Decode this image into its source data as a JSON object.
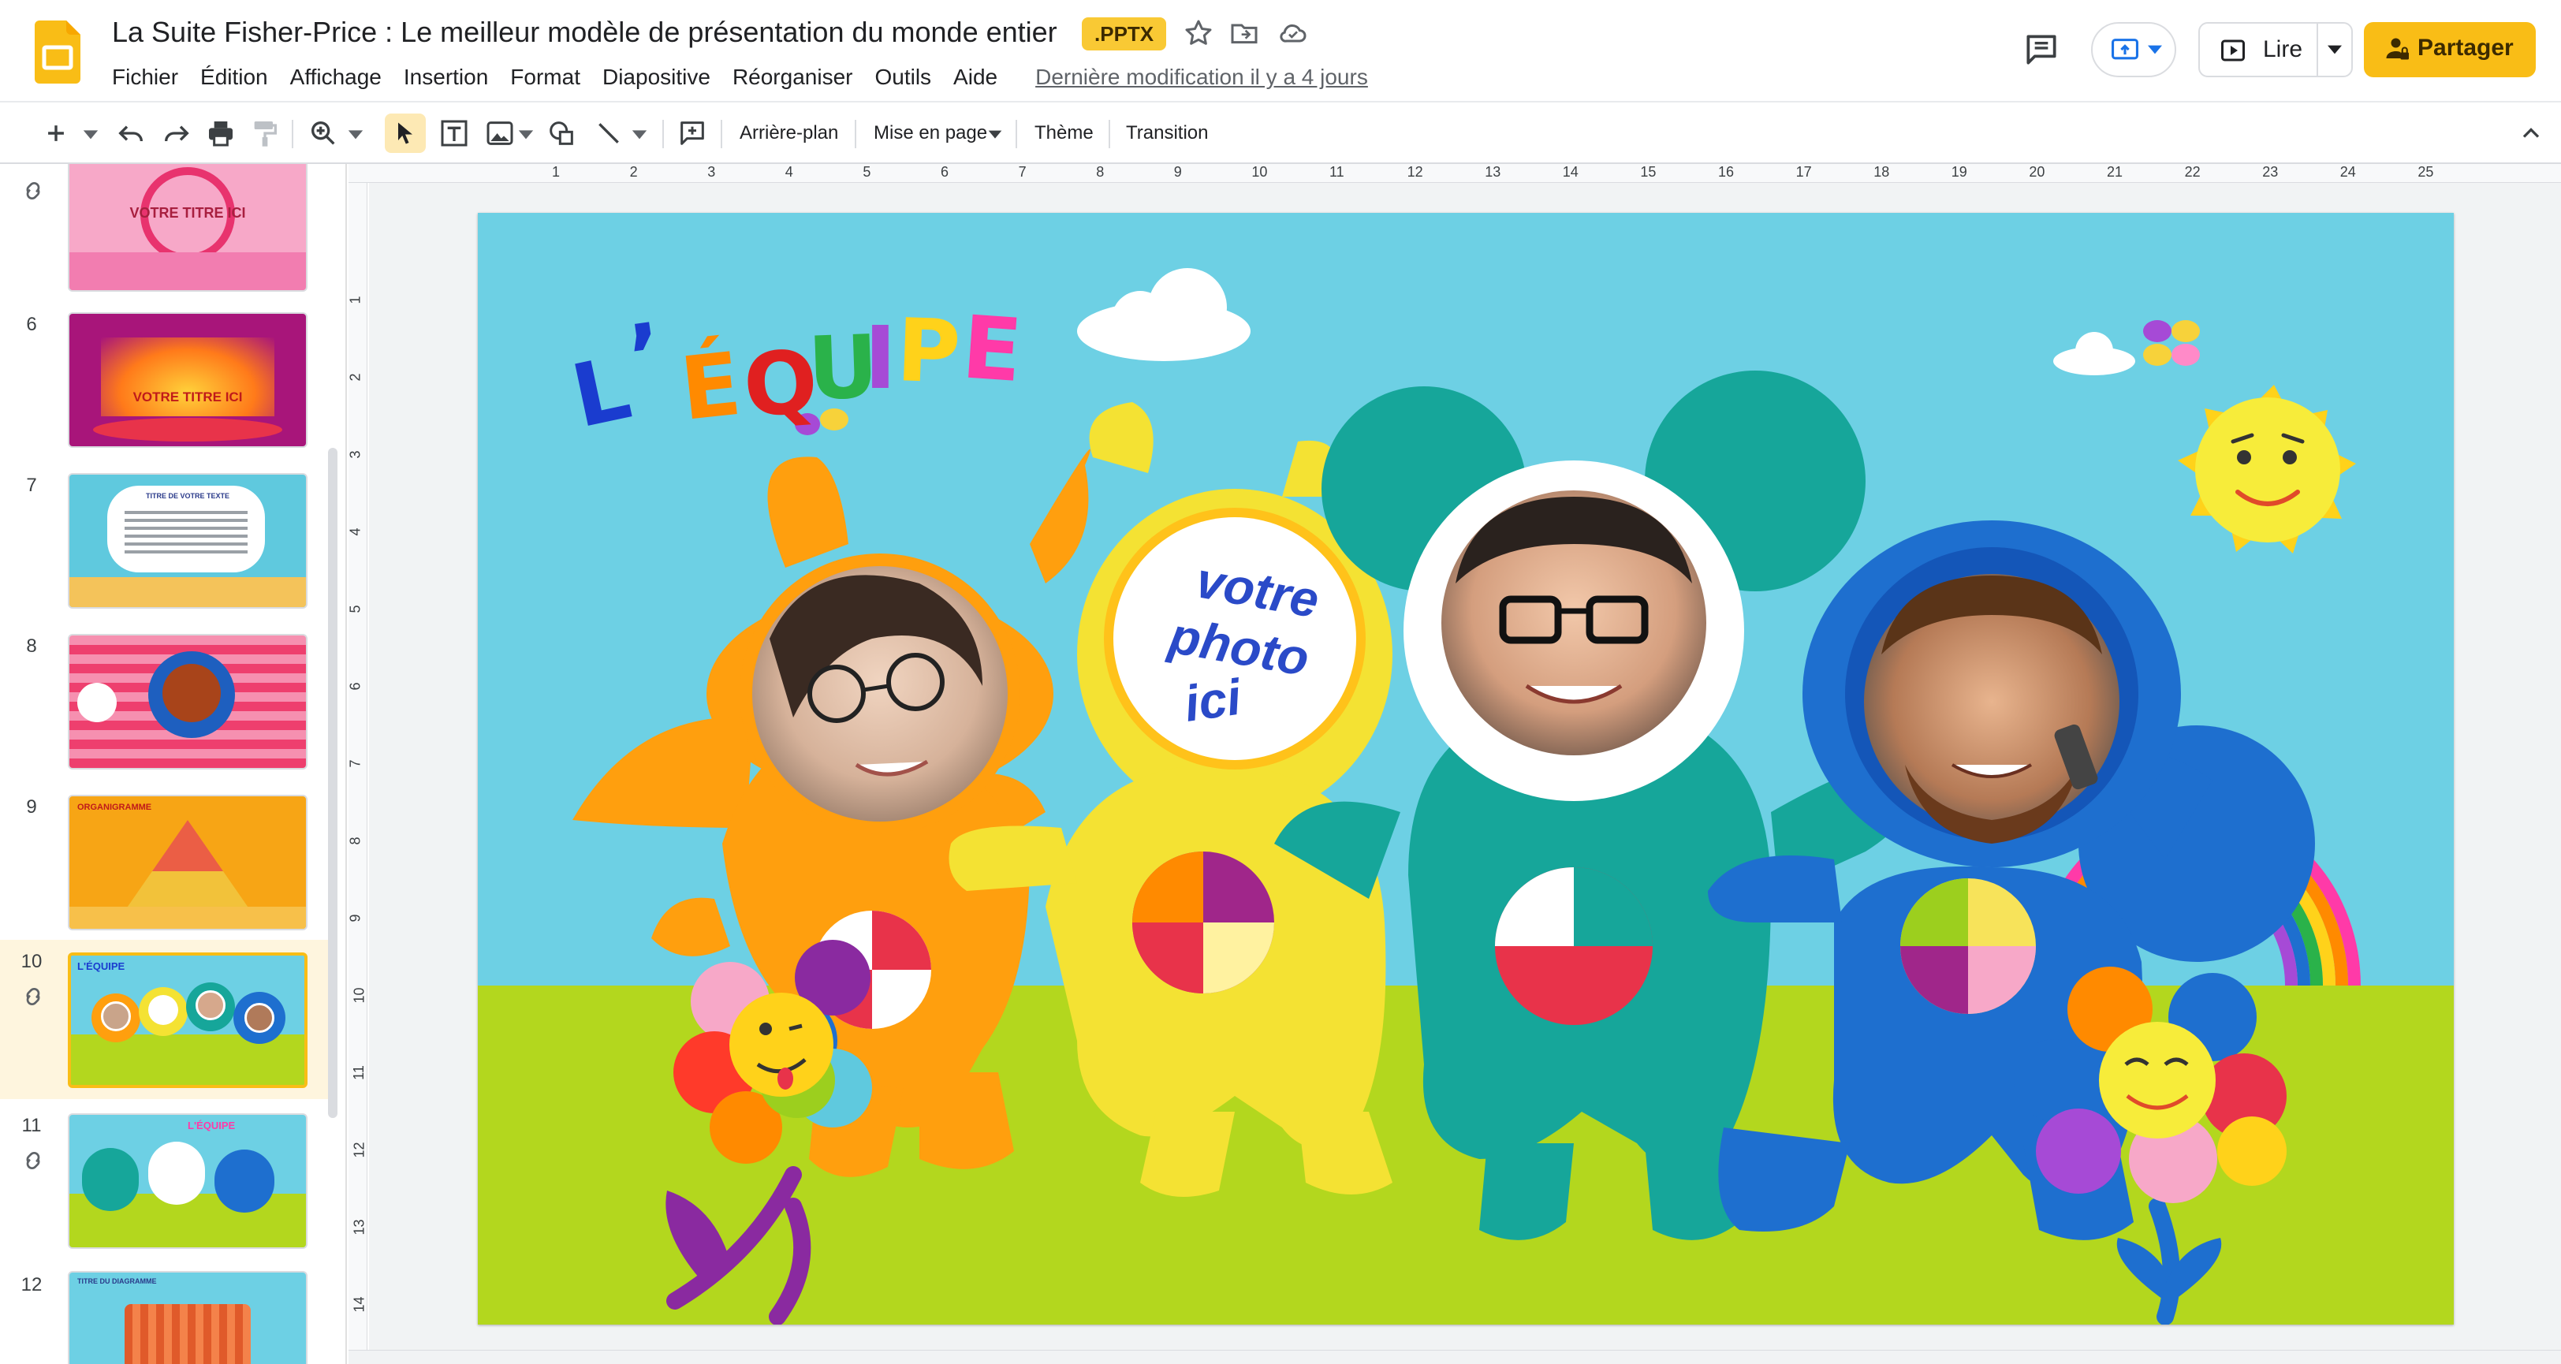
{
  "document": {
    "title": "La Suite Fisher-Price : Le meilleur modèle de présentation du monde entier",
    "format_badge": ".PPTX",
    "last_edit": "Dernière modification il y a 4 jours"
  },
  "menu": {
    "items": [
      "Fichier",
      "Édition",
      "Affichage",
      "Insertion",
      "Format",
      "Diapositive",
      "Réorganiser",
      "Outils",
      "Aide"
    ]
  },
  "header_actions": {
    "present_label": "Lire",
    "share_label": "Partager"
  },
  "toolbar": {
    "background_label": "Arrière-plan",
    "layout_label": "Mise en page",
    "theme_label": "Thème",
    "transition_label": "Transition"
  },
  "filmstrip": {
    "slides": [
      {
        "number": "",
        "caption": "VOTRE TITRE ICI",
        "linked": true,
        "active": false
      },
      {
        "number": "6",
        "caption": "VOTRE TITRE ICI",
        "linked": false,
        "active": false
      },
      {
        "number": "7",
        "caption": "TITRE DE VOTRE TEXTE",
        "linked": false,
        "active": false
      },
      {
        "number": "8",
        "caption": "",
        "linked": false,
        "active": false
      },
      {
        "number": "9",
        "caption": "ORGANIGRAMME",
        "linked": false,
        "active": false
      },
      {
        "number": "10",
        "caption": "L'ÉQUIPE",
        "linked": true,
        "active": true
      },
      {
        "number": "11",
        "caption": "L'ÉQUIPE",
        "linked": true,
        "active": false
      },
      {
        "number": "12",
        "caption": "TITRE DU DIAGRAMME",
        "linked": false,
        "active": false
      }
    ]
  },
  "ruler": {
    "horizontal": [
      "1",
      "2",
      "3",
      "4",
      "5",
      "6",
      "7",
      "8",
      "9",
      "10",
      "11",
      "12",
      "13",
      "14",
      "15",
      "16",
      "17",
      "18",
      "19",
      "20",
      "21",
      "22",
      "23",
      "24",
      "25"
    ],
    "vertical": [
      "1",
      "2",
      "3",
      "4",
      "5",
      "6",
      "7",
      "8",
      "9",
      "10",
      "11",
      "12",
      "13",
      "14"
    ]
  },
  "slide": {
    "title_letters": [
      "L",
      "’",
      "É",
      "Q",
      "U",
      "I",
      "P",
      "E"
    ],
    "title_colors": [
      "#1a3ccf",
      "#1a3ccf",
      "#ff8a00",
      "#e02020",
      "#2ab24a",
      "#a64ad6",
      "#ffd21a",
      "#ff3aa8"
    ],
    "photo_placeholder": [
      "votre",
      "photo",
      "ici"
    ],
    "colors": {
      "sky": "#6dd0e4",
      "grass": "#b3d71e",
      "orange": "#ff9f0e",
      "yellow": "#f4e233",
      "teal": "#16a69a",
      "blue": "#1e6fcf"
    }
  }
}
